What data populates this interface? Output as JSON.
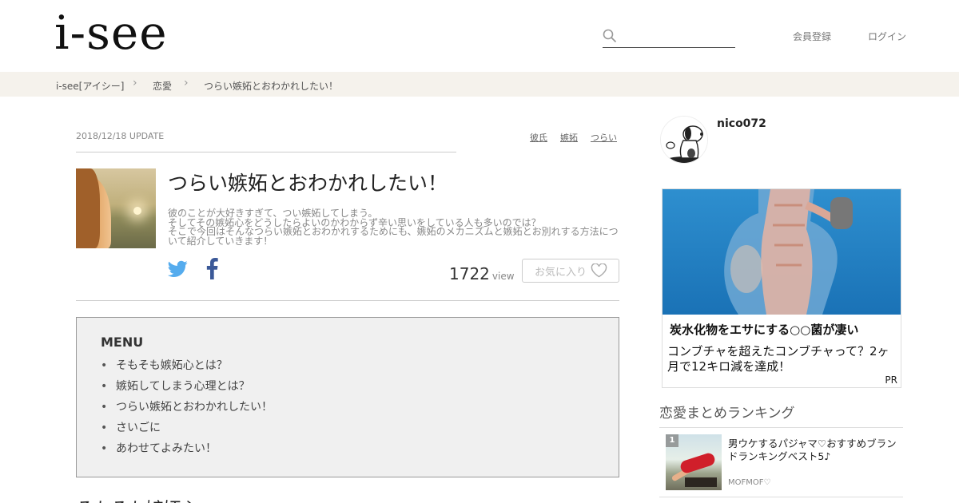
{
  "header": {
    "logo": "i-see",
    "search": {
      "placeholder": "",
      "value": ""
    },
    "nav": {
      "register": "会員登録",
      "login": "ログイン"
    }
  },
  "breadcrumb": [
    "i-see[アイシー]",
    "恋愛",
    "つらい嫉妬とおわかれしたい！"
  ],
  "article": {
    "date": "2018/12/18 UPDATE",
    "tags": [
      "彼氏",
      "嫉妬",
      "つらい"
    ],
    "title": "つらい嫉妬とおわかれしたい！",
    "description_lines": [
      "彼のことが大好きすぎて、つい嫉妬してしまう。",
      "そしてその嫉妬心をどうしたらよいのかわからず辛い思いをしている人も多いのでは？",
      "そこで今回はそんなつらい嫉妬とおわかれするためにも、嫉妬のメカニズムと嫉妬とお別れする方法につ",
      "いて紹介していきます！"
    ],
    "views": "1722",
    "views_unit": "view",
    "favorite_label": "お気に入り"
  },
  "menu": {
    "title": "MENU",
    "items": [
      "そもそも嫉妬心とは？",
      "嫉妬してしまう心理とは？",
      "つらい嫉妬とおわかれしたい！",
      "さいごに",
      "あわせてよみたい！"
    ]
  },
  "next_heading": "そもそも嫉妬心",
  "sidebar": {
    "username": "nico072",
    "ad": {
      "title": "炭水化物をエサにする○○菌が凄い",
      "description": "コンブチャを超えたコンブチャって？2ヶ月で12キロ減を達成！",
      "pr_label": "PR"
    },
    "ranking": {
      "heading": "恋愛まとめランキング",
      "items": [
        {
          "rank": "1",
          "title": "男ウケするパジャマ♡おすすめブランドランキングベスト5♪",
          "author": "MOFMOF♡"
        }
      ]
    }
  },
  "colors": {
    "twitter": "#55acee",
    "facebook": "#3b5998",
    "breadcrumb_bg": "#f5f2ec",
    "ad_bg": "#1a72b6"
  }
}
